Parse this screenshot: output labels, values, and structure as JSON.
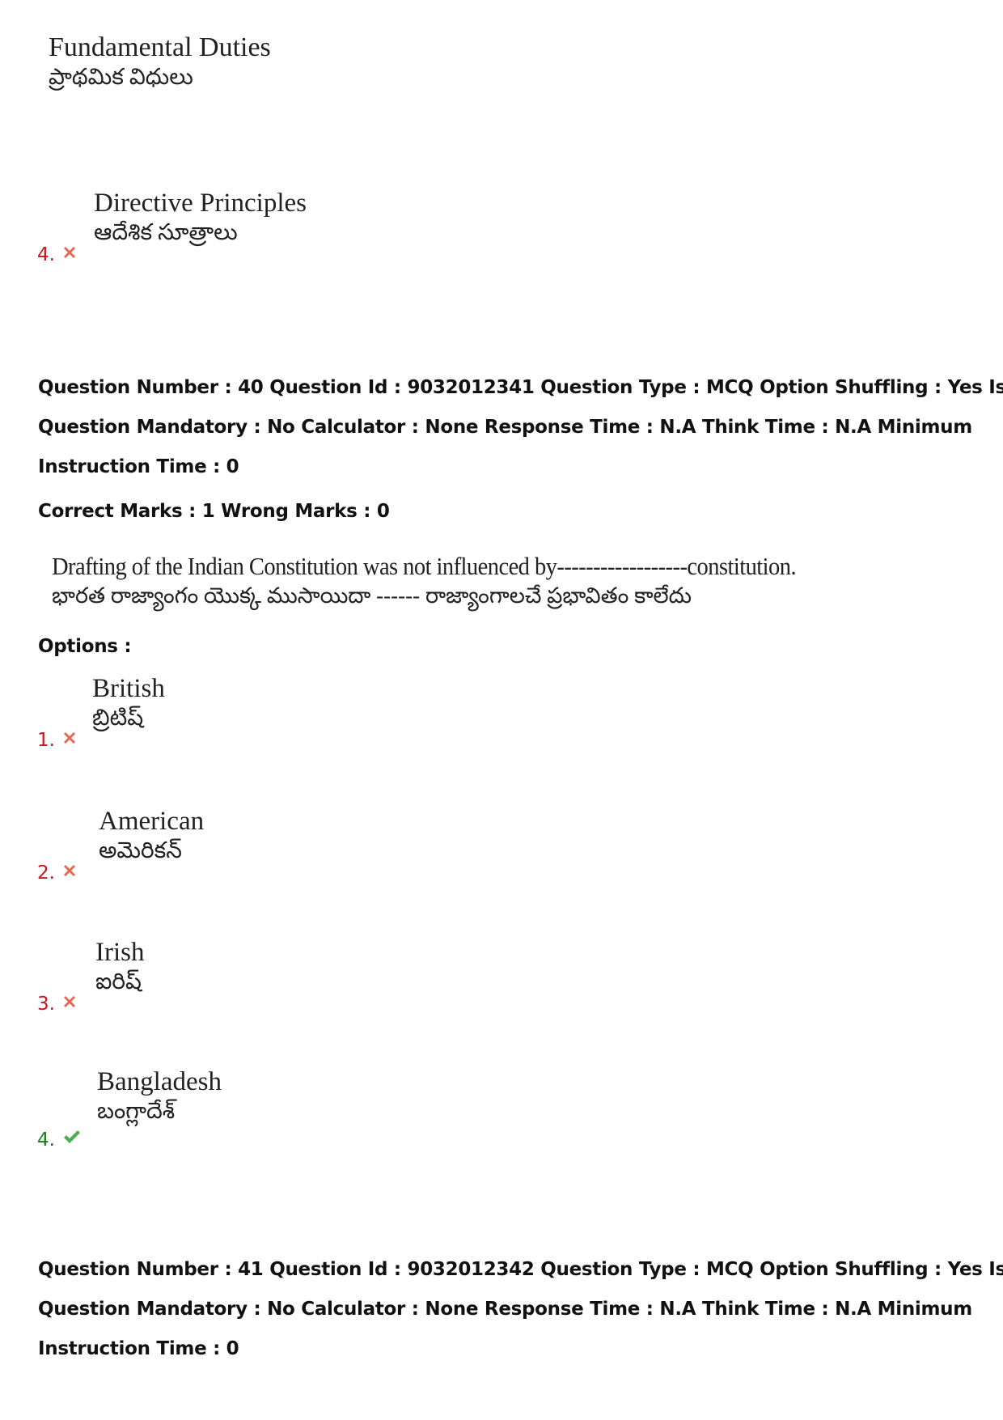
{
  "prev_question_tail": {
    "option_3": {
      "en": "Fundamental Duties",
      "te": "ప్రాథమిక విధులు"
    },
    "option_4": {
      "number": "4.",
      "status": "wrong",
      "icon": "cross-icon",
      "en": "Directive Principles",
      "te": "ఆదేశిక సూత్రాలు"
    }
  },
  "question_40": {
    "meta_line_1": "Question Number : 40 Question Id : 9032012341 Question Type : MCQ Option Shuffling : Yes Is",
    "meta_line_2": "Question Mandatory : No Calculator : None Response Time : N.A Think Time : N.A Minimum",
    "meta_line_3": "Instruction Time : 0",
    "marks": "Correct Marks : 1 Wrong Marks : 0",
    "text_en": "Drafting of the Indian Constitution was not influenced by------------------constitution.",
    "text_te": "భారత రాజ్యాంగం యొక్క ముసాయిదా ------ రాజ్యాంగాలచే ప్రభావితం కాలేదు",
    "options_label": "Options :",
    "options": [
      {
        "number": "1.",
        "status": "wrong",
        "icon": "cross-icon",
        "en": "British",
        "te": "బ్రిటిష్"
      },
      {
        "number": "2.",
        "status": "wrong",
        "icon": "cross-icon",
        "en": "American",
        "te": "అమెరికన్"
      },
      {
        "number": "3.",
        "status": "wrong",
        "icon": "cross-icon",
        "en": "Irish",
        "te": "ఐరిష్"
      },
      {
        "number": "4.",
        "status": "correct",
        "icon": "check-icon",
        "en": "Bangladesh",
        "te": "బంగ్లాదేశ్"
      }
    ]
  },
  "question_41": {
    "meta_line_1": "Question Number : 41 Question Id : 9032012342 Question Type : MCQ Option Shuffling : Yes Is",
    "meta_line_2": "Question Mandatory : No Calculator : None Response Time : N.A Think Time : N.A Minimum",
    "meta_line_3": "Instruction Time : 0"
  },
  "colors": {
    "wrong": "#c8161d",
    "correct": "#1e7a1e",
    "cross_icon": "#e8654f",
    "check_icon": "#4caf50"
  }
}
